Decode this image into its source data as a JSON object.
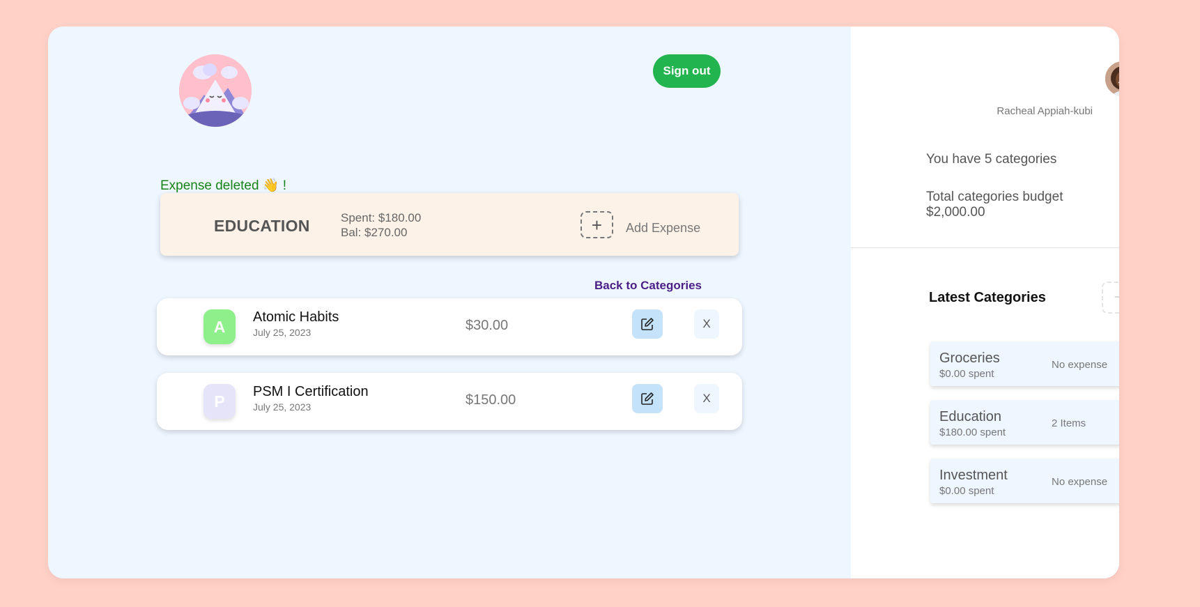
{
  "header": {
    "sign_out_label": "Sign out"
  },
  "toast": {
    "message": "Expense deleted 👋 !"
  },
  "category": {
    "name": "EDUCATION",
    "spent": "Spent: $180.00",
    "balance": "Bal: $270.00",
    "add_icon": "+",
    "add_label": "Add Expense",
    "card_color": "#fcf2e8"
  },
  "back_link": "Back to Categories",
  "expenses": [
    {
      "initial": "A",
      "title": "Atomic Habits",
      "date": "July 25, 2023",
      "amount": "$30.00",
      "avatar_color": "#8ef08a",
      "delete_label": "X"
    },
    {
      "initial": "P",
      "title": "PSM I Certification",
      "date": "July 25, 2023",
      "amount": "$150.00",
      "avatar_color": "#e6e4f8",
      "delete_label": "X"
    }
  ],
  "sidebar": {
    "user_name": "Racheal Appiah-kubi",
    "category_count_text": "You have 5 categories",
    "total_budget_text": "Total categories budget $2,000.00",
    "latest_title": "Latest Categories",
    "add_icon": "+",
    "latest_categories": [
      {
        "name": "Groceries",
        "spent": "$0.00 spent",
        "count": "No expense"
      },
      {
        "name": "Education",
        "spent": "$180.00 spent",
        "count": "2 Items"
      },
      {
        "name": "Investment",
        "spent": "$0.00 spent",
        "count": "No expense"
      }
    ]
  },
  "colors": {
    "page_background": "#ffd1c7",
    "panel_background": "#eef6ff",
    "sign_out": "#22b44e",
    "toast": "#168416",
    "back_link": "#4b1e86",
    "edit_button": "#c5e2fb"
  },
  "icons": {
    "logo": "cloud-mountain-logo",
    "edit": "edit-icon",
    "user": "user-avatar"
  }
}
